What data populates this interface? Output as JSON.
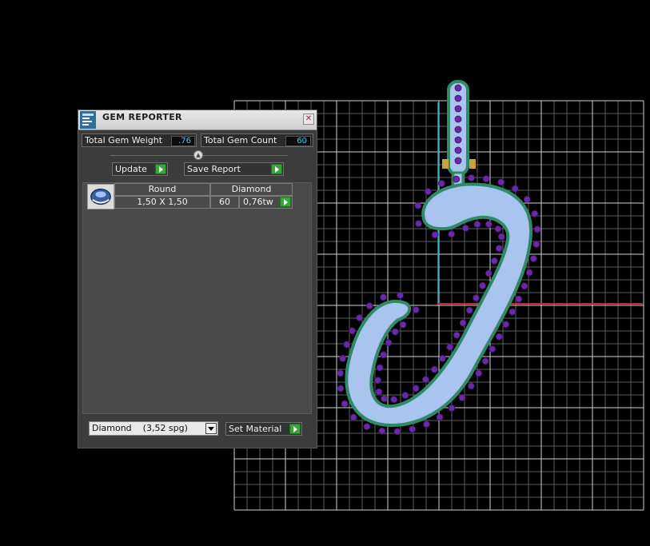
{
  "viewport": {
    "grid_color": "#c8c8c8",
    "x_axis_color": "#c4282d",
    "y_axis_color": "#1fa3b6",
    "shape_fill": "#aac4f0",
    "shape_outline": "#2f8a68",
    "gem_color": "#6a2aa8"
  },
  "gem_reporter": {
    "title": "GEM REPORTER",
    "app_icon": "gem-reporter-app-icon",
    "close_icon": "close-icon",
    "total_weight_label": "Total Gem Weight",
    "total_weight_value": ".76",
    "total_count_label": "Total Gem Count",
    "total_count_value": "60",
    "update_label": "Update",
    "save_report_label": "Save Report",
    "table": {
      "headers": [
        "Round",
        "Diamond"
      ],
      "rows": [
        {
          "size": "1,50 X 1,50",
          "count": "60",
          "weight": "0,76tw"
        }
      ]
    },
    "material_select_value": "Diamond    (3,52 spg)",
    "set_material_label": "Set Material"
  }
}
